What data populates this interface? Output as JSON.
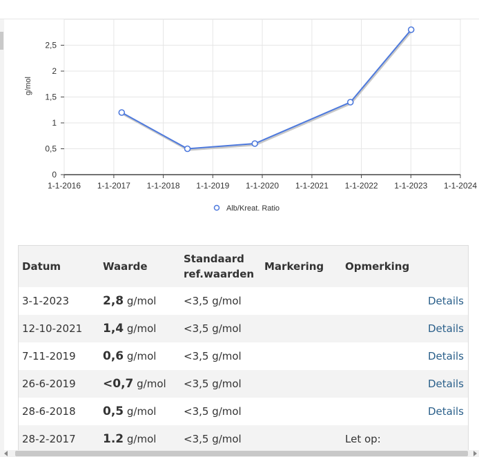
{
  "chart_data": {
    "type": "line",
    "xlabel": "",
    "ylabel": "g/mol",
    "ylim": [
      0,
      3
    ],
    "y_ticks": [
      "0",
      "0,5",
      "1",
      "1,5",
      "2",
      "2,5"
    ],
    "y_tick_values": [
      0,
      0.5,
      1,
      1.5,
      2,
      2.5
    ],
    "x_ticks": [
      "1-1-2016",
      "1-1-2017",
      "1-1-2018",
      "1-1-2019",
      "1-1-2020",
      "1-1-2021",
      "1-1-2022",
      "1-1-2023",
      "1-1-2024"
    ],
    "x_range": [
      "2016-01-01",
      "2024-01-01"
    ],
    "grid": true,
    "legend_position": "bottom",
    "series": [
      {
        "name": "Alb/Kreat. Ratio",
        "color": "#4d79dd",
        "points": [
          {
            "x": "2017-02-28",
            "y": 1.2
          },
          {
            "x": "2018-06-28",
            "y": 0.5
          },
          {
            "x": "2019-11-07",
            "y": 0.6
          },
          {
            "x": "2021-10-12",
            "y": 1.4
          },
          {
            "x": "2023-01-03",
            "y": 2.8
          }
        ]
      }
    ]
  },
  "table": {
    "headers": {
      "datum": "Datum",
      "waarde": "Waarde",
      "standaard": "Standaard ref.waarden",
      "markering": "Markering",
      "opmerking": "Opmerking"
    },
    "rows": [
      {
        "datum": "3-1-2023",
        "value": "2,8",
        "unit": "g/mol",
        "ref": "<3,5 g/mol",
        "markering": "",
        "opmerking": "",
        "details": "Details"
      },
      {
        "datum": "12-10-2021",
        "value": "1,4",
        "unit": "g/mol",
        "ref": "<3,5 g/mol",
        "markering": "",
        "opmerking": "",
        "details": "Details"
      },
      {
        "datum": "7-11-2019",
        "value": "0,6",
        "unit": "g/mol",
        "ref": "<3,5 g/mol",
        "markering": "",
        "opmerking": "",
        "details": "Details"
      },
      {
        "datum": "26-6-2019",
        "value": "<0,7",
        "unit": "g/mol",
        "ref": "<3,5 g/mol",
        "markering": "",
        "opmerking": "",
        "details": "Details"
      },
      {
        "datum": "28-6-2018",
        "value": "0,5",
        "unit": "g/mol",
        "ref": "<3,5 g/mol",
        "markering": "",
        "opmerking": "",
        "details": "Details"
      },
      {
        "datum": "28-2-2017",
        "value": "1.2",
        "unit": "g/mol",
        "ref": "<3,5 g/mol",
        "markering": "",
        "opmerking": "Let op:",
        "details": ""
      }
    ]
  }
}
